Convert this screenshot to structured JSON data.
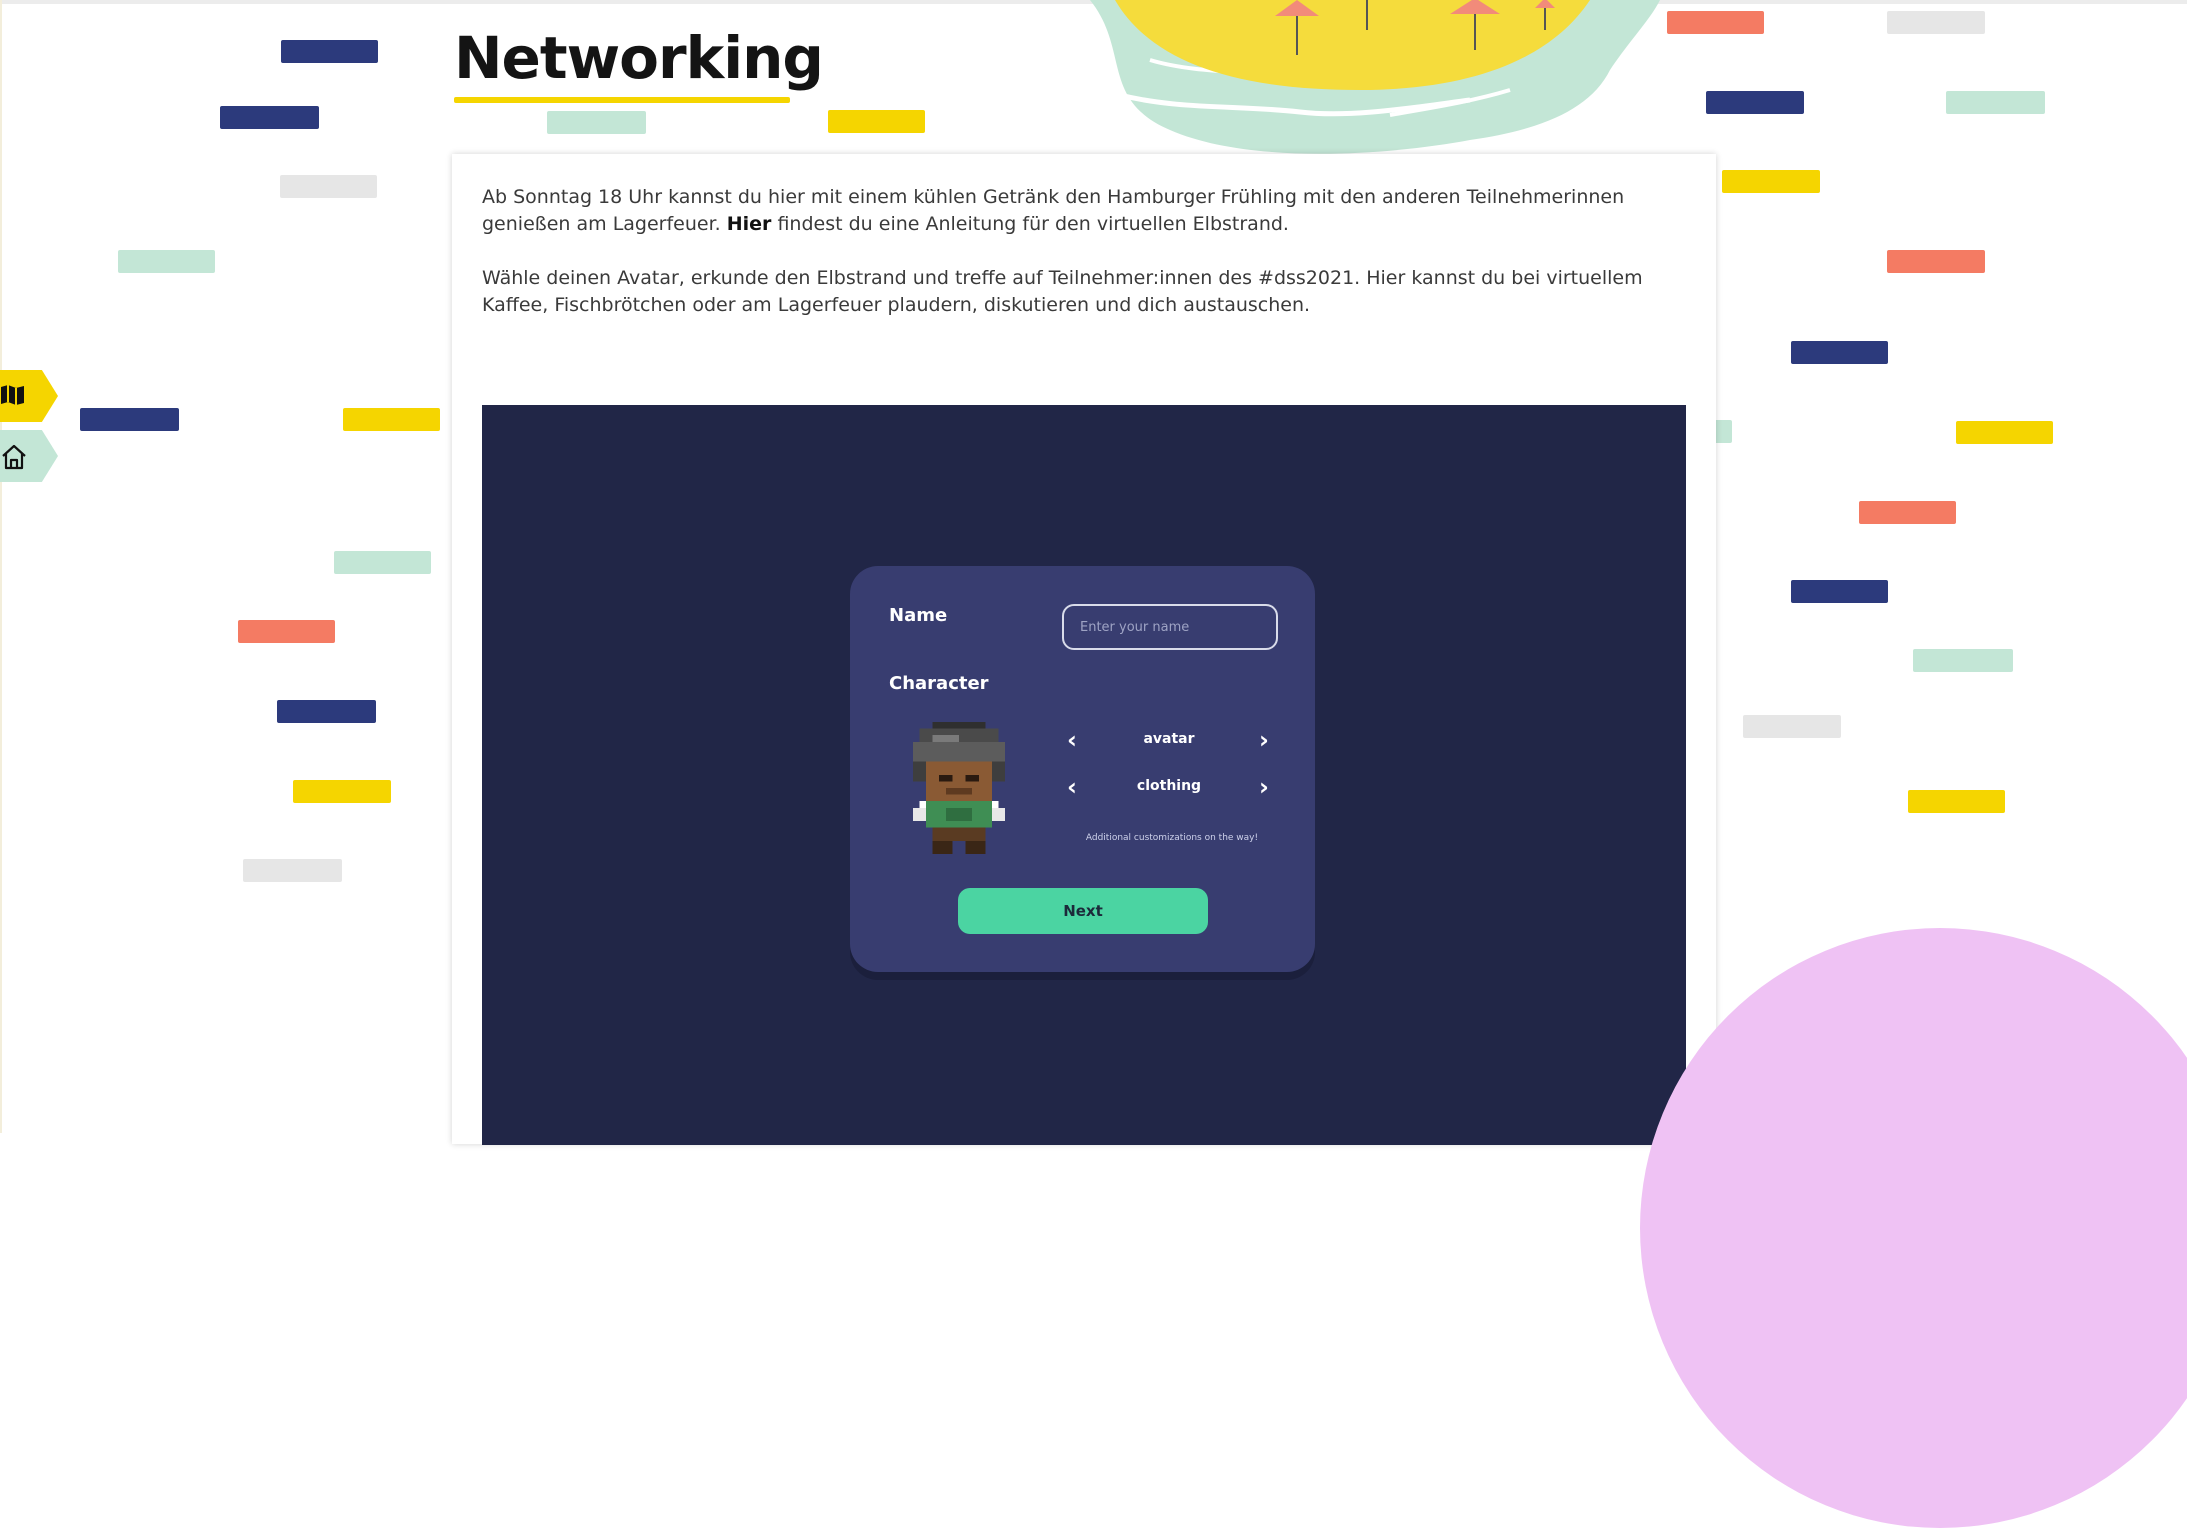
{
  "header": {
    "title": "Networking"
  },
  "intro": {
    "p1_before": "Ab Sonntag 18 Uhr kannst du hier mit einem kühlen Getränk den Hamburger Frühling mit den anderen Teilnehmerinnen genießen am Lagerfeuer. ",
    "p1_link": "Hier",
    "p1_after": " findest du eine Anleitung für den virtuellen Elbstrand.",
    "p2": "Wähle deinen Avatar, erkunde den Elbstrand und treffe auf Teilnehmer:innen des #dss2021. Hier kannst du bei virtuellem Kaffee, Fischbrötchen oder am Lagerfeuer plaudern, diskutieren und dich austauschen."
  },
  "avatar_form": {
    "name_label": "Name",
    "name_placeholder": "Enter your name",
    "name_value": "",
    "character_label": "Character",
    "options": [
      {
        "label": "avatar"
      },
      {
        "label": "clothing"
      }
    ],
    "hint": "Additional customizations on the way!",
    "next_label": "Next"
  },
  "side_nav": {
    "items": [
      {
        "icon": "map-icon",
        "active": true
      },
      {
        "icon": "home-icon",
        "active": false
      }
    ]
  },
  "colors": {
    "navy": "#2c3a7c",
    "mint": "#c3e6d6",
    "gray": "#e6e6e6",
    "coral": "#f47b63",
    "yellow": "#f5d500",
    "game_bg": "#212647",
    "panel_bg": "#383d70",
    "button": "#4bd4a2",
    "pink": "#efc2f4"
  }
}
